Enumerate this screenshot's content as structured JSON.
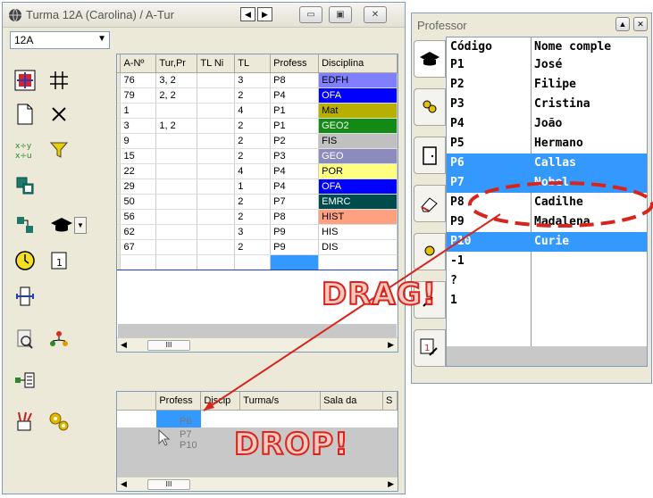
{
  "turma_window": {
    "title": "Turma 12A (Carolina) / A-Tur",
    "class_select": "12A",
    "grid": {
      "columns": [
        "A-Nº",
        "Tur,Pr",
        "TL Ni",
        "TL",
        "Profess",
        "Disciplina"
      ],
      "rows": [
        {
          "an": "76",
          "turpr": "3, 2",
          "tlni": "",
          "tl": "3",
          "prof": "P8",
          "disc": "EDFH",
          "color": "#8080ff",
          "text_color": "#000000"
        },
        {
          "an": "79",
          "turpr": "2, 2",
          "tlni": "",
          "tl": "2",
          "prof": "P4",
          "disc": "OFA",
          "color": "#0000ff",
          "text_color": "#ffffff"
        },
        {
          "an": "1",
          "turpr": "",
          "tlni": "",
          "tl": "4",
          "prof": "P1",
          "disc": "Mat",
          "color": "#b8b000",
          "text_color": "#000000"
        },
        {
          "an": "3",
          "turpr": "1, 2",
          "tlni": "",
          "tl": "2",
          "prof": "P1",
          "disc": "GEO2",
          "color": "#138a13",
          "text_color": "#ffffff"
        },
        {
          "an": "9",
          "turpr": "",
          "tlni": "",
          "tl": "2",
          "prof": "P2",
          "disc": "FIS",
          "color": "#c0c0c0",
          "text_color": "#000000"
        },
        {
          "an": "15",
          "turpr": "",
          "tlni": "",
          "tl": "2",
          "prof": "P3",
          "disc": "GEO",
          "color": "#8b8bbd",
          "text_color": "#ffffff"
        },
        {
          "an": "22",
          "turpr": "",
          "tlni": "",
          "tl": "4",
          "prof": "P4",
          "disc": "POR",
          "color": "#ffff80",
          "text_color": "#000000"
        },
        {
          "an": "29",
          "turpr": "",
          "tlni": "",
          "tl": "1",
          "prof": "P4",
          "disc": "OFA",
          "color": "#0000ff",
          "text_color": "#ffffff"
        },
        {
          "an": "50",
          "turpr": "",
          "tlni": "",
          "tl": "2",
          "prof": "P7",
          "disc": "EMRC",
          "color": "#004b4b",
          "text_color": "#ffffff"
        },
        {
          "an": "56",
          "turpr": "",
          "tlni": "",
          "tl": "2",
          "prof": "P8",
          "disc": "HIST",
          "color": "#ffa080",
          "text_color": "#000000"
        },
        {
          "an": "62",
          "turpr": "",
          "tlni": "",
          "tl": "3",
          "prof": "P9",
          "disc": "HIS",
          "color": "#ffffff",
          "text_color": "#000000"
        },
        {
          "an": "67",
          "turpr": "",
          "tlni": "",
          "tl": "2",
          "prof": "P9",
          "disc": "DIS",
          "color": "#ffffff",
          "text_color": "#000000"
        }
      ],
      "scroll_thumb": "III"
    },
    "lower_grid": {
      "columns": [
        "Profess",
        "Discip",
        "Turma/s",
        "Sala da",
        "S"
      ],
      "drag_items": [
        "P6",
        "P7",
        "P10"
      ],
      "scroll_thumb": "III"
    }
  },
  "professor_window": {
    "title": "Professor",
    "columns": [
      "Código",
      "Nome comple"
    ],
    "rows": [
      {
        "code": "P1",
        "name": "José",
        "selected": false
      },
      {
        "code": "P2",
        "name": "Filipe",
        "selected": false
      },
      {
        "code": "P3",
        "name": "Cristina",
        "selected": false
      },
      {
        "code": "P4",
        "name": "João",
        "selected": false
      },
      {
        "code": "P5",
        "name": "Hermano",
        "selected": false
      },
      {
        "code": "P6",
        "name": "Callas",
        "selected": true
      },
      {
        "code": "P7",
        "name": "Nobel",
        "selected": true
      },
      {
        "code": "P8",
        "name": "Cadilhe",
        "selected": false
      },
      {
        "code": "P9",
        "name": "Madalena",
        "selected": false
      },
      {
        "code": "P10",
        "name": "Curie",
        "selected": true
      },
      {
        "code": "-1",
        "name": "",
        "selected": false
      },
      {
        "code": "?",
        "name": "",
        "selected": false
      },
      {
        "code": "1",
        "name": "",
        "selected": false
      }
    ]
  },
  "annotations": {
    "drag": "DRAG!",
    "drop": "DROP!",
    "color": "#d9241c"
  }
}
